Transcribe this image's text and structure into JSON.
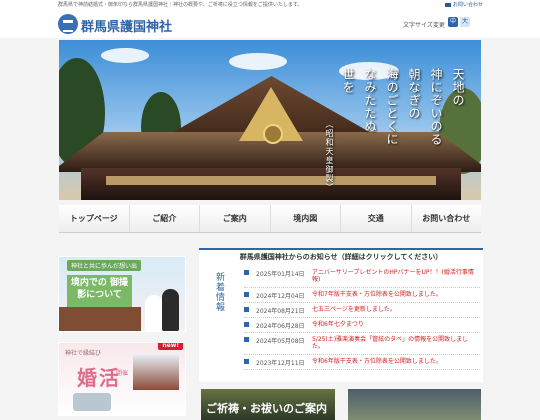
{
  "topbar": {
    "message": "群馬県で神前結婚式・御朱印なら群馬県護国神社｜神社の概要や、ご祈祷に役立つ情報をご提供いたします。",
    "contact": "お問い合わせ"
  },
  "header": {
    "title": "群馬県護国神社",
    "font_size_label": "文字サイズ変更",
    "font_mid": "中",
    "font_big": "大"
  },
  "hero": {
    "poem": [
      "天地の",
      "神にぞいのる",
      "朝なぎの",
      "海のごとくに",
      "なみたたぬ",
      "世を"
    ],
    "poem_small": "（昭和天皇御製）"
  },
  "nav": {
    "items": [
      "トップページ",
      "ご紹介",
      "ご案内",
      "境内図",
      "交通",
      "お問い合わせ"
    ]
  },
  "banners": {
    "left_top": {
      "title": "神社と共に歩んだ想い出",
      "text": "境内での\n御撮影について"
    },
    "left_bottom": {
      "new": "new!",
      "line1": "神社で縁結び",
      "big": "婚活",
      "sub": "開催"
    }
  },
  "news": {
    "title": "群馬県護国神社からのお知らせ（詳細はクリックしてください）",
    "side": "新着情報",
    "items": [
      {
        "date": "2025年01月14日",
        "text": "アニバーサリープレゼントのHPバナーをUP！！(婚活行事情報)"
      },
      {
        "date": "2024年12月04日",
        "text": "令和7年版干支表・方位除表を公開致しました。"
      },
      {
        "date": "2024年08月21日",
        "text": "七五三ページを更新しました。"
      },
      {
        "date": "2024年06月28日",
        "text": "令和6年七夕まつり"
      },
      {
        "date": "2024年05月08日",
        "text": "5/25(土)雅楽演奏会「管絃のタベ」の情報を公開致しました。"
      },
      {
        "date": "2023年12月11日",
        "text": "令和6年版干支表・方位除表を公開致しました。"
      }
    ]
  },
  "footer": {
    "left": "ご祈祷・お祓いのご案内"
  },
  "colors": {
    "primary": "#2f64aa",
    "link": "#d32020"
  }
}
